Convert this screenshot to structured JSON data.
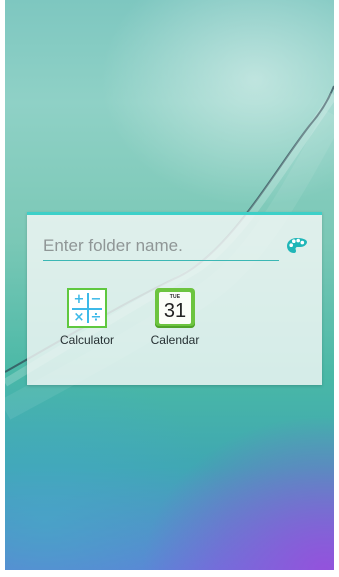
{
  "folder": {
    "name_placeholder": "Enter folder name.",
    "name_value": "",
    "apps": [
      {
        "label": "Calculator",
        "icon": "calculator-icon",
        "symbols": [
          "+",
          "−",
          "×",
          "÷"
        ]
      },
      {
        "label": "Calendar",
        "icon": "calendar-icon",
        "day": "TUE",
        "date": "31"
      }
    ]
  },
  "colors": {
    "accent": "#3dd0c8",
    "palette_icon": "#1fb6b8",
    "calculator_border": "#5fc83f",
    "calculator_symbols": "#3db9e8",
    "calendar_green": "#6cc43f"
  }
}
